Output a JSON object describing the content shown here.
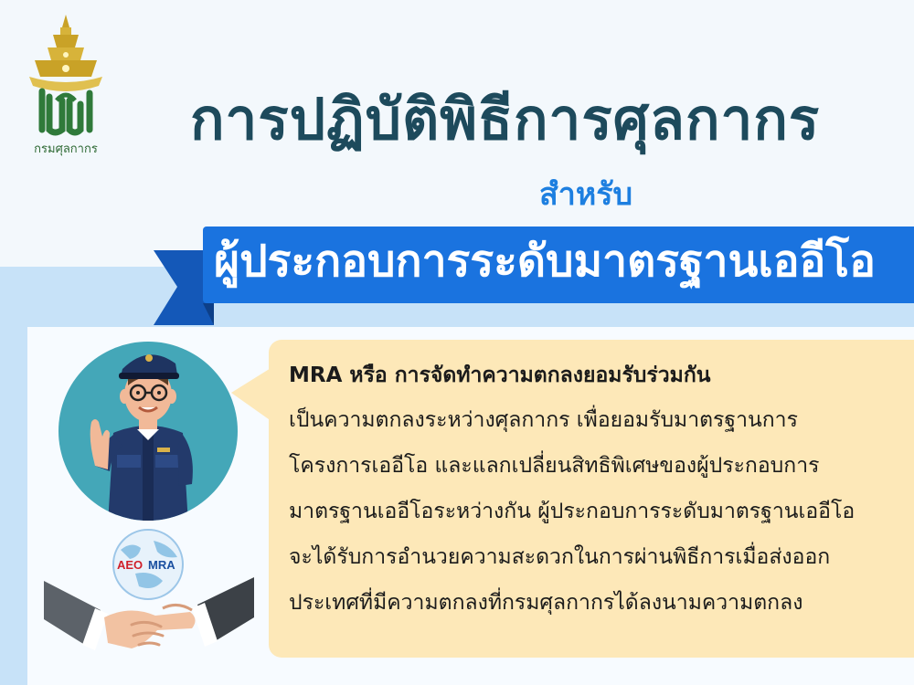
{
  "logo": {
    "caption": "กรมศุลกากร"
  },
  "header": {
    "title": "การปฏิบัติพิธีการศุลกากร",
    "subtitle": "สำหรับ",
    "ribbon": "ผู้ประกอบการระดับมาตรฐานเออีโอ"
  },
  "globe": {
    "label_left": "AEO",
    "label_right": "MRA"
  },
  "bubble": {
    "heading": "MRA  หรือ  การจัดทำความตกลงยอมรับร่วมกัน",
    "lines": [
      "เป็นความตกลงระหว่างศุลกากร  เพื่อยอมรับมาตรฐานการ",
      "โครงการเออีโอ   และแลกเปลี่ยนสิทธิพิเศษของผู้ประกอบการ",
      "มาตรฐานเออีโอระหว่างกัน  ผู้ประกอบการระดับมาตรฐานเออีโอ",
      "จะได้รับการอำนวยความสะดวกในการผ่านพิธีการเมื่อส่งออก",
      "ประเทศที่มีความตกลงที่กรมศุลกากรได้ลงนามความตกลง"
    ]
  },
  "colors": {
    "title": "#1d4a5c",
    "subtitle": "#1d7fe0",
    "ribbon": "#1a73df",
    "band": "#c7e2f8",
    "bubble": "#fde8b8"
  }
}
